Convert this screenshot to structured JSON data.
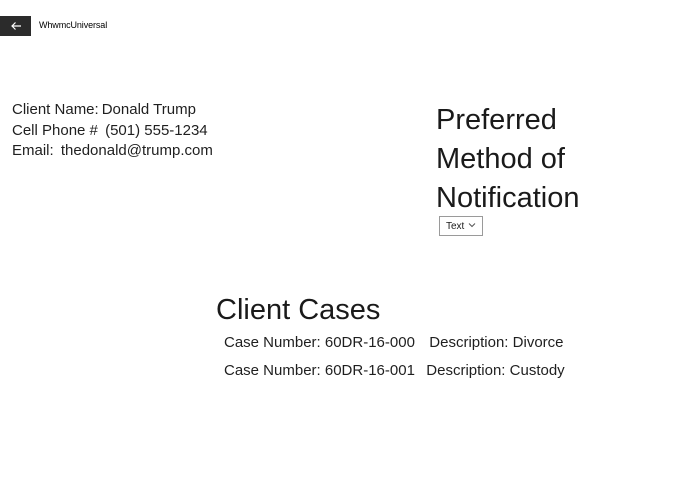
{
  "app": {
    "title": "WhwmcUniversal",
    "back_icon": "arrow-left-icon"
  },
  "client": {
    "name_label": "Client Name:",
    "name_value": "Donald Trump",
    "phone_label": "Cell Phone #",
    "phone_value": "(501) 555-1234",
    "email_label": "Email:",
    "email_value": "thedonald@trump.com"
  },
  "notification": {
    "title": "Preferred Method of Notification",
    "selected": "Text",
    "chevron_icon": "chevron-down-icon"
  },
  "cases": {
    "title": "Client Cases",
    "items": [
      {
        "number_label": "Case Number:",
        "number": "60DR-16-000",
        "description_label": "Description:",
        "description": "Divorce"
      },
      {
        "number_label": "Case Number:",
        "number": "60DR-16-001",
        "description_label": "Description:",
        "description": "Custody"
      }
    ]
  }
}
